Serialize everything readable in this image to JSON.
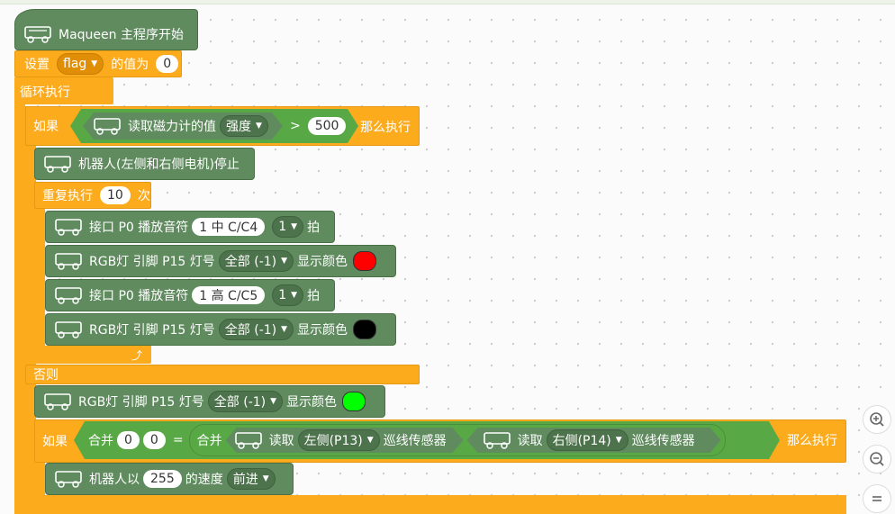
{
  "colors": {
    "red": "#ff0000",
    "black": "#000000",
    "green": "#00ff00",
    "block_green": "#5f8b5f",
    "block_orange": "#fcab1c"
  },
  "icons": {
    "maqueen": "maqueen-robot-icon"
  },
  "program": {
    "start_label": "Maqueen 主程序开始",
    "set": {
      "prefix": "设置",
      "var": "flag",
      "suffix": "的值为",
      "value": "0"
    },
    "loop_label": "循环执行",
    "if1": {
      "label": "如果",
      "read_label": "读取磁力计的值",
      "read_option": "强度",
      "op": ">",
      "value": "500",
      "then": "那么执行"
    },
    "stop_motors": "机器人(左侧和右侧电机)停止",
    "repeat": {
      "prefix": "重复执行",
      "count": "10",
      "suffix": "次"
    },
    "tone1": {
      "prefix": "接口 P0 播放音符",
      "note": "1 中 C/C4",
      "beats": "1",
      "suffix": "拍"
    },
    "rgb1": {
      "prefix": "RGB灯 引脚 P15 灯号",
      "led": "全部 (-1)",
      "suffix": "显示颜色",
      "color": "#ff0000"
    },
    "tone2": {
      "prefix": "接口 P0 播放音符",
      "note": "1 高 C/C5",
      "beats": "1",
      "suffix": "拍"
    },
    "rgb2": {
      "prefix": "RGB灯 引脚 P15 灯号",
      "led": "全部 (-1)",
      "suffix": "显示颜色",
      "color": "#000000"
    },
    "else_label": "否则",
    "rgb3": {
      "prefix": "RGB灯 引脚 P15 灯号",
      "led": "全部 (-1)",
      "suffix": "显示颜色",
      "color": "#00ff00"
    },
    "if2": {
      "label": "如果",
      "join_label": "合并",
      "a": "0",
      "b": "0",
      "eq": "=",
      "join2": "合并",
      "read": "读取",
      "left": "左侧(P13)",
      "sensor": "巡线传感器",
      "right": "右侧(P14)",
      "then": "那么执行"
    },
    "drive": {
      "prefix": "机器人以",
      "speed": "255",
      "mid": "的速度",
      "dir": "前进"
    }
  },
  "zoom": {
    "in": "zoom-in-icon",
    "out": "zoom-out-icon",
    "reset": "zoom-reset-icon"
  }
}
